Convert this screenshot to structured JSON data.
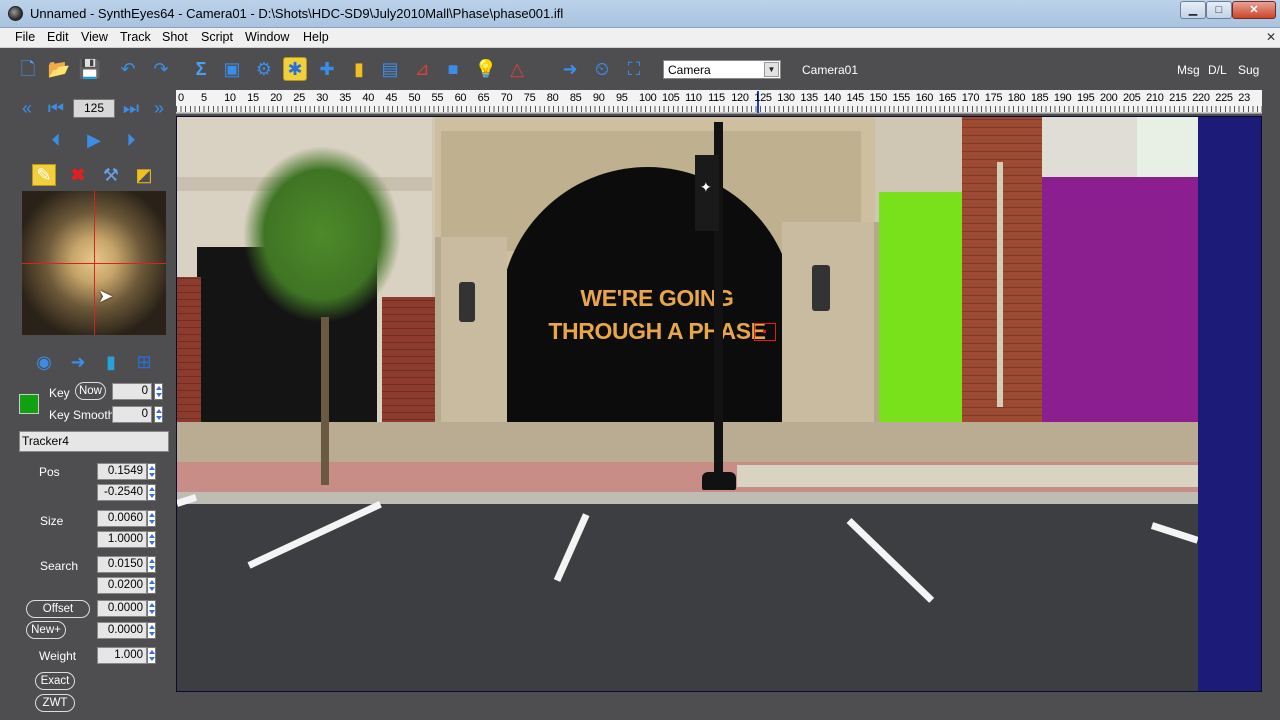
{
  "window": {
    "title": "Unnamed - SynthEyes64 - Camera01 - D:\\Shots\\HDC-SD9\\July2010Mall\\Phase\\phase001.ifl"
  },
  "menu": [
    "File",
    "Edit",
    "View",
    "Track",
    "Shot",
    "Script",
    "Window",
    "Help"
  ],
  "toolbar": {
    "room_select": "Camera",
    "active_object": "Camera01",
    "links": [
      "Msg",
      "D/L",
      "Sug"
    ]
  },
  "playback": {
    "frame": "125"
  },
  "tracker": {
    "name": "Tracker4",
    "key_label": "Key",
    "key_now": "Now",
    "key_value": "0",
    "key_smooth_label": "Key Smooth",
    "key_smooth_value": "0",
    "color": "#11a011",
    "pos_label": "Pos",
    "pos_x": "0.1549",
    "pos_y": "-0.2540",
    "size_label": "Size",
    "size_x": "0.0060",
    "size_y": "1.0000",
    "search_label": "Search",
    "search_x": "0.0150",
    "search_y": "0.0200",
    "offset_label": "Offset",
    "offset_value": "0.0000",
    "new_label": "New+",
    "new_value": "0.0000",
    "weight_label": "Weight",
    "weight_value": "1.000",
    "exact_label": "Exact",
    "zwt_label": "ZWT"
  },
  "timeline": {
    "ticks": [
      "0",
      "5",
      "10",
      "15",
      "20",
      "25",
      "30",
      "35",
      "40",
      "45",
      "50",
      "55",
      "60",
      "65",
      "70",
      "75",
      "80",
      "85",
      "90",
      "95",
      "100",
      "105",
      "110",
      "115",
      "120",
      "125",
      "130",
      "135",
      "140",
      "145",
      "150",
      "155",
      "160",
      "165",
      "170",
      "175",
      "180",
      "185",
      "190",
      "195",
      "200",
      "205",
      "210",
      "215",
      "220",
      "225",
      "23"
    ],
    "current_frame": 125
  },
  "viewport": {
    "sign_line1": "WE'RE GOING",
    "sign_line2": "THROUGH A PHASE"
  }
}
